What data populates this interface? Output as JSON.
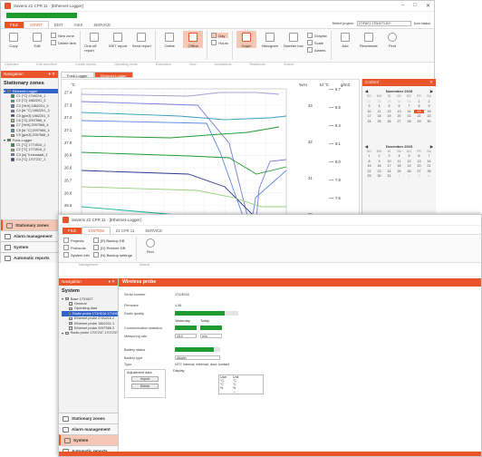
{
  "w1": {
    "title": "Saveris 21 CFR 11 - [Ethernet-Logger]",
    "tabs": [
      "FILE",
      "START",
      "EDIT",
      "AXIS",
      "SERVICE"
    ],
    "active_tab": "START",
    "project_label": "Select project:",
    "project_value": "1TIF8Z1 1T0H271-81*",
    "icon_status": "Icon status",
    "ribbon": {
      "copy": "Copy",
      "edit": "Edit",
      "new_zone": "New zone",
      "delete_item": "Delete item",
      "one_off_report": "One-off report",
      "mkt_report": "MKT report",
      "send_report": "Send report",
      "online": "Online",
      "offline": "Offline",
      "day": "Day",
      "hours": "Hours",
      "graph": "Graph",
      "histogram": "Histogram",
      "number_box": "Number box",
      "graphic": "Graphic",
      "scale": "Scale",
      "alarms": "Alarms",
      "add": "Add",
      "readmode": "Readmode",
      "find": "Find"
    },
    "groups": [
      "Clipboard",
      "Edit zone/item",
      "Create reports",
      "Operating mode",
      "Evaluation",
      "View",
      "Annotations",
      "Readmode",
      "Search"
    ],
    "nav": {
      "header": "Navigation",
      "title": "Stationary zones",
      "tree": [
        {
          "label": "Ethernet-Logger",
          "color": "#3064c8",
          "level": 0,
          "selected": true
        },
        {
          "label": "C1 [°C] 2746216_1",
          "color": "#1f9a2e",
          "level": 1
        },
        {
          "label": "C2 [°C] 1862201_3",
          "color": "#1fb89a",
          "level": 1
        },
        {
          "label": "C3 [%rH] 1862201_3",
          "color": "#5a8be0",
          "level": 1
        },
        {
          "label": "C4 [td °C] 1862201_3",
          "color": "#8a5ad0",
          "level": 1
        },
        {
          "label": "C5 [g/m3] 1862201_3",
          "color": "#2a3a90",
          "level": 1
        },
        {
          "label": "C6 [°C] 2097566_4",
          "color": "#9ad07a",
          "level": 1
        },
        {
          "label": "C7 [%rH] 2097566_4",
          "color": "#7a5090",
          "level": 1
        },
        {
          "label": "C8 [td °C] 2097566_4",
          "color": "#3aa0c0",
          "level": 1
        },
        {
          "label": "C9 [g/m3] 2097566_4",
          "color": "#c0b050",
          "level": 1
        },
        {
          "label": "Funk-Logger",
          "color": "#1f9a2e",
          "level": 0
        },
        {
          "label": "C1 [°C] 1774516_1",
          "color": "#1f9a2e",
          "level": 1
        },
        {
          "label": "C2 [°C] 1774516_2",
          "color": "#9ad07a",
          "level": 1
        },
        {
          "label": "C3 [m] Turbostadt_3",
          "color": "#5a8be0",
          "level": 1
        },
        {
          "label": "C4 [°C] 1707237_1",
          "color": "#2a3a90",
          "level": 1
        }
      ],
      "buttons": [
        "Stationary zones",
        "Alarm management",
        "System",
        "Automatic reports"
      ]
    },
    "doc_tabs": [
      "Funk-Logger",
      "Ethernet-Logger"
    ],
    "chart_units": {
      "left": "°C",
      "u1": "%rH",
      "u2": "td °C",
      "u3": "g/m3"
    },
    "left_ticks": [
      "27.4",
      "27.3",
      "27.2",
      "27.1",
      "27.0",
      "26.9",
      "26.8",
      "26.7",
      "26.6",
      "26.5",
      "26.4",
      "26.3",
      "26.2",
      "26.1"
    ],
    "rh_ticks": [
      "33",
      "32",
      "31",
      "30",
      "29"
    ],
    "td_ticks": [
      "8.7",
      "8.5",
      "8.3",
      "8.1",
      "8.0",
      "7.8",
      "7.6",
      "7.5",
      "7.3",
      "7.1"
    ],
    "calendar": {
      "header": "Control",
      "months": [
        {
          "name": "November 2019",
          "days": [
            "SO",
            "MO",
            "DI",
            "MI",
            "DO",
            "FR",
            "SA"
          ],
          "weeks": [
            [
              "27",
              "28",
              "29",
              "30",
              "31",
              "1",
              "2"
            ],
            [
              "3",
              "4",
              "5",
              "6",
              "7",
              "8",
              "9"
            ],
            [
              "10",
              "11",
              "12",
              "13",
              "14",
              "15",
              "16"
            ],
            [
              "17",
              "18",
              "19",
              "20",
              "21",
              "22",
              "23"
            ],
            [
              "24",
              "25",
              "26",
              "27",
              "28",
              "29",
              "30"
            ]
          ],
          "today": "15"
        },
        {
          "name": "December 2019",
          "days": [
            "SO",
            "MO",
            "DI",
            "MI",
            "DO",
            "FR",
            "SA"
          ],
          "weeks": [
            [
              "1",
              "2",
              "3",
              "4",
              "5",
              "6",
              "7"
            ],
            [
              "8",
              "9",
              "10",
              "11",
              "12",
              "13",
              "14"
            ],
            [
              "15",
              "16",
              "17",
              "18",
              "19",
              "20",
              "21"
            ],
            [
              "22",
              "23",
              "24",
              "25",
              "26",
              "27",
              "28"
            ],
            [
              "29",
              "30",
              "31",
              "1",
              "2",
              "3",
              "4"
            ]
          ]
        }
      ]
    }
  },
  "w2": {
    "title": "Saveris 21 CFR 11 - [Ethernet-Logger]",
    "tabs": [
      "FILE",
      "SYSTEM",
      "21 CFR 11",
      "SERVICE"
    ],
    "active_tab": "SYSTEM",
    "ribbon_col1": [
      "Projects",
      "Protocols",
      "System info"
    ],
    "ribbon_col2": [
      "(E) Backup DB",
      "(D) Restore DB",
      "(N) Backup settings"
    ],
    "find": "Find",
    "ribbon_groups": [
      "Management",
      "Search"
    ],
    "nav": {
      "header": "Navigation",
      "title": "System",
      "tree": [
        {
          "label": "Base 1T91627",
          "level": 0
        },
        {
          "label": "General",
          "level": 1
        },
        {
          "label": "Operating data",
          "level": 1
        },
        {
          "label": "Radio probe 1T1H016 1T1H018",
          "level": 1,
          "selected": true
        },
        {
          "label": "Ethernet probe 2746216 2",
          "level": 1
        },
        {
          "label": "Ethernet probe 1862201 1",
          "level": 1
        },
        {
          "label": "Ethernet probe 2097566 2",
          "level": 1
        },
        {
          "label": "Radio probe 1707237 1707237",
          "level": 0
        }
      ],
      "buttons": [
        "Stationary zones",
        "Alarm management",
        "System",
        "Automatic reports"
      ],
      "active_button": "System"
    },
    "probe": {
      "header": "Wireless probe",
      "serial_label": "Serial number",
      "serial": "1T1H018",
      "firmware_label": "Firmware",
      "firmware": "1.36",
      "radio_quality_label": "Radio quality",
      "radio_quality": 0.78,
      "comm_label": "Communication statistics",
      "comm_cols": [
        "Yesterday",
        "Today"
      ],
      "comm_values": [
        1.0,
        1.0
      ],
      "rate_label": "Measuring rate",
      "rate_value": "15.0",
      "rate_unit": "min",
      "battery_status_label": "Battery status",
      "battery_status": 0.85,
      "battery_type_label": "Battery type",
      "battery_type": "Alkalin",
      "type_label": "Type",
      "type": "NTC internal, external, door contact",
      "adjust_label": "Adjustment data",
      "import_btn": "Import",
      "delete_btn": "Delete",
      "display_label": "Display",
      "display_table": {
        "headers": [
          "User",
          "Unit"
        ],
        "rows": [
          [
            "°C",
            "°C"
          ],
          [
            "°C",
            "°C"
          ],
          [
            "%",
            "%"
          ],
          [
            "",
            "---"
          ]
        ]
      }
    }
  }
}
